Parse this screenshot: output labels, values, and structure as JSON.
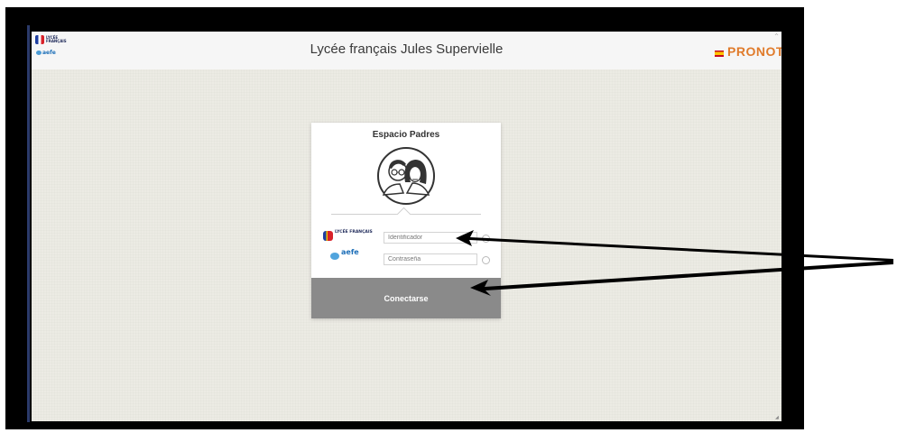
{
  "header": {
    "title": "Lycée français Jules Supervielle",
    "brand": "PRONOTE",
    "logo_top_text": "LYCÉE FRANÇAIS",
    "aefe_text": "aefe"
  },
  "login": {
    "title": "Espacio Padres",
    "logo_text": "LYCÉE FRANÇAIS",
    "aefe_text": "aefe",
    "identifier_placeholder": "Identificador",
    "password_placeholder": "Contraseña",
    "connect_label": "Conectarse"
  },
  "colors": {
    "background": "#ecebe4",
    "button": "#8a8a8a",
    "frame": "#000000"
  },
  "icons": [
    "parents-avatar-icon",
    "radio-icon",
    "spain-flag-icon",
    "annotation-arrow"
  ]
}
